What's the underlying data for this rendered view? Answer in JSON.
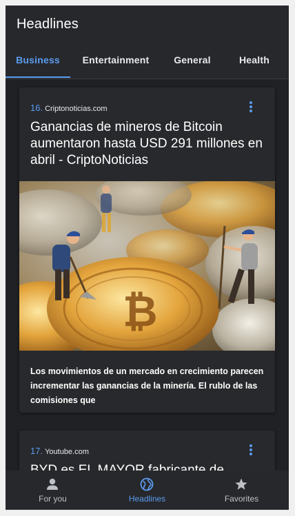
{
  "app": {
    "title": "Headlines"
  },
  "tabs": [
    {
      "label": "Business",
      "active": true
    },
    {
      "label": "Entertainment",
      "active": false
    },
    {
      "label": "General",
      "active": false
    },
    {
      "label": "Health",
      "active": false
    }
  ],
  "articles": [
    {
      "number": "16.",
      "source": "Criptonoticias.com",
      "title": "Ganancias de mineros de Bitcoin aumentaron hasta USD 291 millones en abril - CriptoNoticias",
      "description": "Los movimientos de un mercado en crecimiento parecen incrementar las ganancias de la minería. El rublo de las comisiones que",
      "image": "miniature-miners-on-bitcoin-coins"
    },
    {
      "number": "17.",
      "source": "Youtube.com",
      "title": "BYD es EL MAYOR fabricante de"
    }
  ],
  "bottom_nav": [
    {
      "label": "For you",
      "icon": "person-icon",
      "active": false
    },
    {
      "label": "Headlines",
      "icon": "globe-icon",
      "active": true
    },
    {
      "label": "Favorites",
      "icon": "star-icon",
      "active": false
    }
  ],
  "colors": {
    "accent": "#5b9cf0",
    "background": "#202124",
    "surface": "#28292c",
    "text": "#ffffff"
  }
}
